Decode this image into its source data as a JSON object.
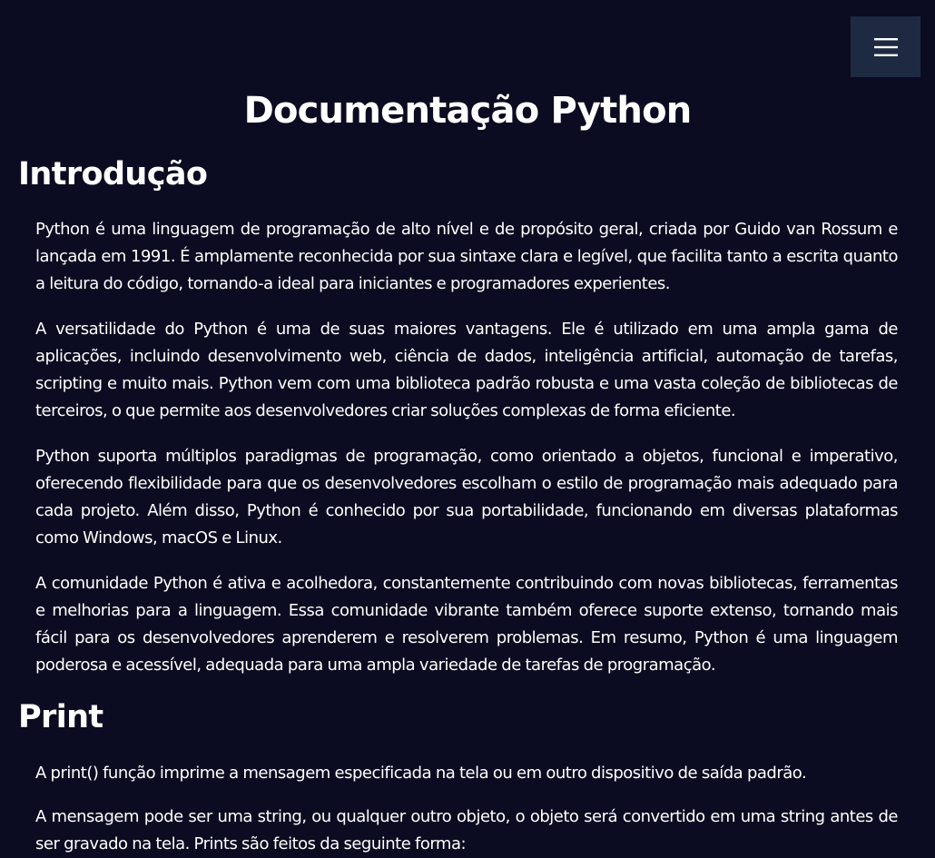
{
  "header": {
    "menu_icon": "hamburger-menu-icon",
    "menu_button_color": "#1e2a42"
  },
  "page": {
    "title": "Documentação Python",
    "background_color": "#0b0b21",
    "text_color": "#ffffff"
  },
  "sections": [
    {
      "heading": "Introdução",
      "paragraphs": [
        "Python é uma linguagem de programação de alto nível e de propósito geral, criada por Guido van Rossum e lançada em 1991. É amplamente reconhecida por sua sintaxe clara e legível, que facilita tanto a escrita quanto a leitura do código, tornando-a ideal para iniciantes e programadores experientes.",
        "A versatilidade do Python é uma de suas maiores vantagens. Ele é utilizado em uma ampla gama de aplicações, incluindo desenvolvimento web, ciência de dados, inteligência artificial, automação de tarefas, scripting e muito mais. Python vem com uma biblioteca padrão robusta e uma vasta coleção de bibliotecas de terceiros, o que permite aos desenvolvedores criar soluções complexas de forma eficiente.",
        "Python suporta múltiplos paradigmas de programação, como orientado a objetos, funcional e imperativo, oferecendo flexibilidade para que os desenvolvedores escolham o estilo de programação mais adequado para cada projeto. Além disso, Python é conhecido por sua portabilidade, funcionando em diversas plataformas como Windows, macOS e Linux.",
        "A comunidade Python é ativa e acolhedora, constantemente contribuindo com novas bibliotecas, ferramentas e melhorias para a linguagem. Essa comunidade vibrante também oferece suporte extenso, tornando mais fácil para os desenvolvedores aprenderem e resolverem problemas. Em resumo, Python é uma linguagem poderosa e acessível, adequada para uma ampla variedade de tarefas de programação."
      ]
    },
    {
      "heading": "Print",
      "paragraphs": [
        "A print() função imprime a mensagem especificada na tela ou em outro dispositivo de saída padrão.",
        "A mensagem pode ser uma string, ou qualquer outro objeto, o objeto será convertido em uma string antes de ser gravado na tela. Prints são feitos da seguinte forma:"
      ]
    }
  ]
}
